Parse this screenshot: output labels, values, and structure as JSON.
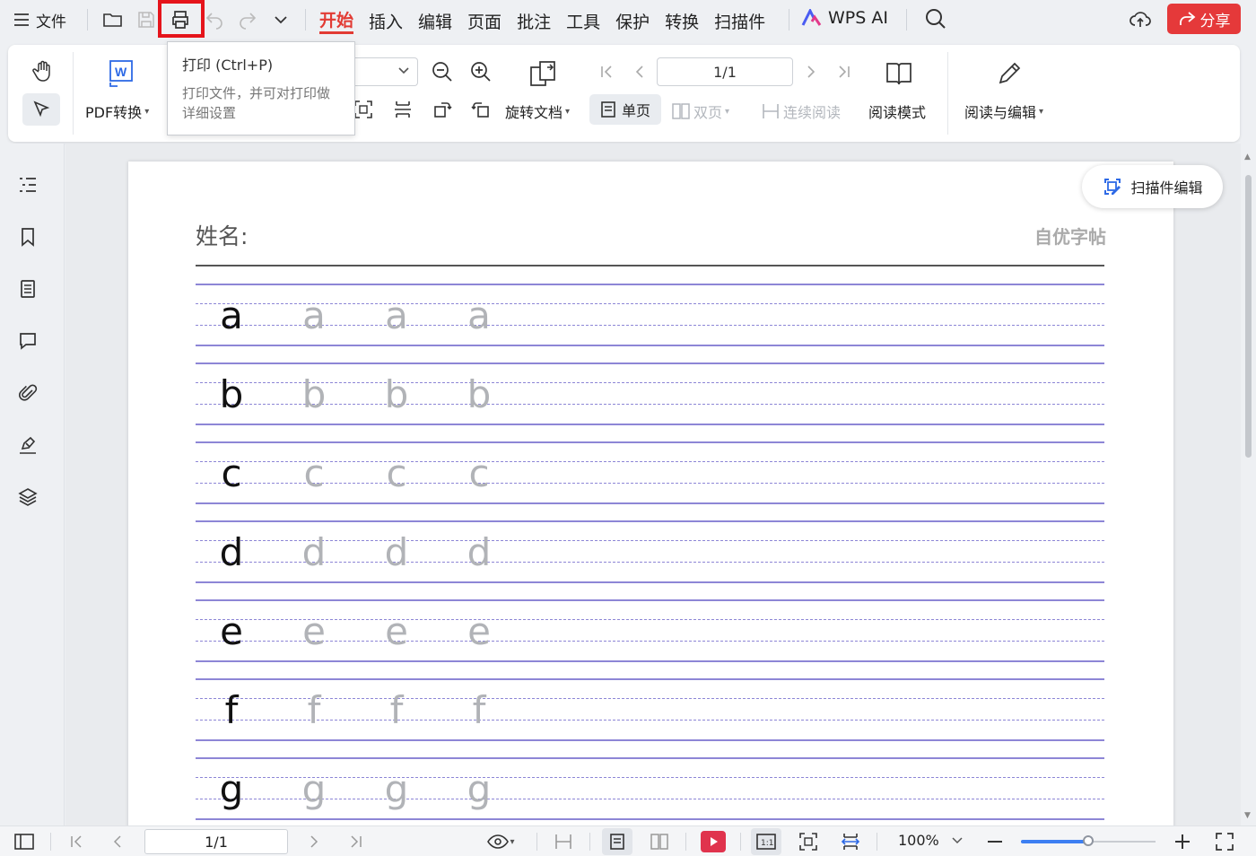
{
  "menubar": {
    "file_label": "文件",
    "tabs": [
      {
        "label": "开始",
        "active": true
      },
      {
        "label": "插入",
        "active": false
      },
      {
        "label": "编辑",
        "active": false
      },
      {
        "label": "页面",
        "active": false
      },
      {
        "label": "批注",
        "active": false
      },
      {
        "label": "工具",
        "active": false
      },
      {
        "label": "保护",
        "active": false
      },
      {
        "label": "转换",
        "active": false
      },
      {
        "label": "扫描件",
        "active": false
      }
    ],
    "wps_ai_label": "WPS AI",
    "share_label": "分享"
  },
  "tooltip": {
    "title": "打印 (Ctrl+P)",
    "description": "打印文件，并可对打印做详细设置"
  },
  "ribbon": {
    "pdf_convert_label": "PDF转换",
    "rotate_doc_label": "旋转文档",
    "page_value": "1/1",
    "single_page_label": "单页",
    "double_page_label": "双页",
    "continuous_label": "连续阅读",
    "read_mode_label": "阅读模式",
    "read_edit_label": "阅读与编辑"
  },
  "document": {
    "name_label": "姓名:",
    "brand_label": "自优字帖",
    "scan_edit_label": "扫描件编辑",
    "letters": [
      "a",
      "b",
      "c",
      "d",
      "e",
      "f",
      "g"
    ],
    "guide_line_color": "#8d86d6"
  },
  "statusbar": {
    "page_value": "1/1",
    "zoom_value": "100%",
    "zoom_fraction": 0.5
  },
  "colors": {
    "accent": "#e23b34",
    "share_bg": "#e5393a",
    "slider": "#3d7ff2"
  }
}
